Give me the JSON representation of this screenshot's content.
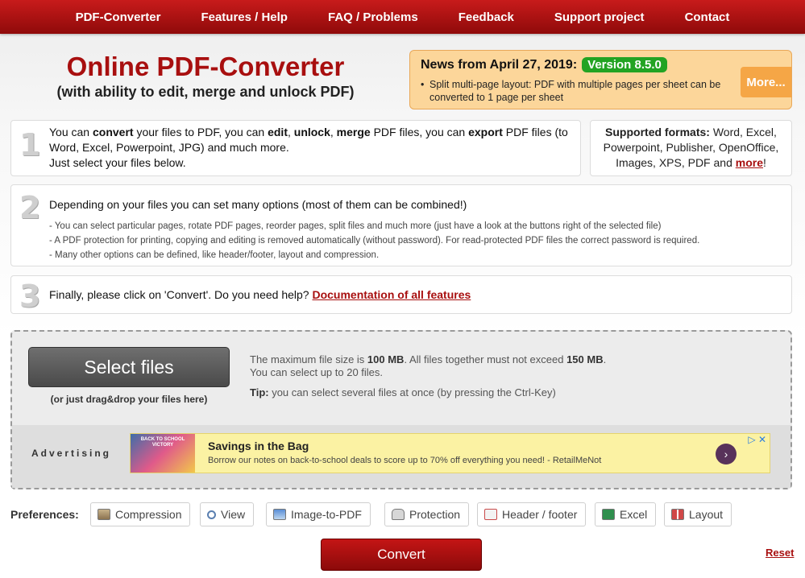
{
  "nav": {
    "items": [
      "PDF-Converter",
      "Features / Help",
      "FAQ / Problems",
      "Feedback",
      "Support project",
      "Contact"
    ]
  },
  "header": {
    "title": "Online PDF-Converter",
    "subtitle": "(with ability to edit, merge and unlock PDF)"
  },
  "news": {
    "heading": "News from April 27, 2019:",
    "version": "Version 8.5.0",
    "item": "Split multi-page layout: PDF with multiple pages per sheet can be converted to 1 page per sheet",
    "more": "More..."
  },
  "steps": {
    "step1": {
      "number": "1",
      "t1": "You can ",
      "convert": "convert",
      "t2": " your files to PDF, you can ",
      "edit": "edit",
      "t3": ", ",
      "unlock": "unlock",
      "t4": ", ",
      "merge": "merge",
      "t5": " PDF files, you can ",
      "export": "export",
      "t6": " PDF files (to Word, Excel, Powerpoint, JPG) and much more.",
      "line2": "Just select your files below."
    },
    "formats": {
      "label": "Supported formats:",
      "text": " Word, Excel, Powerpoint, Publisher, OpenOffice, Images, XPS, PDF and ",
      "more": "more",
      "end": "!"
    },
    "step2": {
      "number": "2",
      "heading": "Depending on your files you can set many options (most of them can be combined!)",
      "bullets": [
        "- You can select particular pages, rotate PDF pages, reorder pages, split files and much more (just have a look at the buttons right of the selected file)",
        "- A PDF protection for printing, copying and editing is removed automatically (without password). For read-protected PDF files the correct password is required.",
        "- Many other options can be defined, like header/footer, layout and compression."
      ]
    },
    "step3": {
      "number": "3",
      "text": "Finally, please click on 'Convert'. Do you need help? ",
      "link": "Documentation of all features"
    }
  },
  "upload": {
    "button": "Select files",
    "drag_note": "(or just drag&drop your files here)",
    "info1a": "The maximum file size is ",
    "max_size": "100 MB",
    "info1b": ". All files together must not exceed ",
    "total_size": "150 MB",
    "info1c": ".",
    "info2": "You can select up to 20 files.",
    "tip_label": "Tip:",
    "tip": " you can select several files at once (by pressing the Ctrl-Key)"
  },
  "ad": {
    "label": "Advertising",
    "image_text": "BACK TO SCHOOL VICTORY",
    "title": "Savings in the Bag",
    "text": "Borrow our notes on back-to-school deals to score up to 70% off everything you need! - RetailMeNot",
    "arrow": "›",
    "close": "▷ ✕"
  },
  "preferences": {
    "label": "Preferences:",
    "buttons": [
      "Compression",
      "View",
      "Image-to-PDF",
      "Protection",
      "Header / footer",
      "Excel",
      "Layout"
    ]
  },
  "actions": {
    "convert": "Convert",
    "reset": "Reset"
  }
}
